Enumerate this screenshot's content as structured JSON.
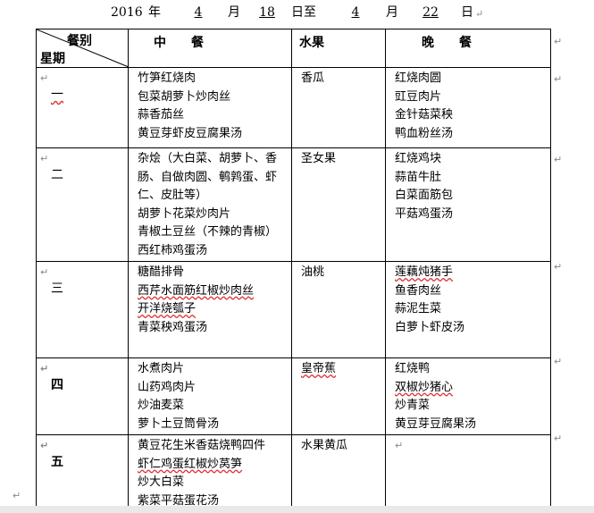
{
  "header": {
    "year": "2016",
    "year_char": "年",
    "start_month": "4",
    "month_char": "月",
    "start_day": "18",
    "day_to_char": "日至",
    "end_month": "4",
    "month_char2": "月",
    "end_day": "22",
    "day_char": "日"
  },
  "table": {
    "diag_top": "餐别",
    "diag_bottom": "星期",
    "col_lunch": "中　　餐",
    "col_fruit": "水果",
    "col_dinner": "晚　　餐",
    "rows": [
      {
        "day": "一",
        "lunch": [
          "竹笋红烧肉",
          "包菜胡萝卜炒肉丝",
          "蒜香茄丝",
          "黄豆芽虾皮豆腐果汤"
        ],
        "fruit": "香瓜",
        "dinner": [
          "红烧肉圆",
          "豇豆肉片",
          "金针菇菜秧",
          "鸭血粉丝汤"
        ]
      },
      {
        "day": "二",
        "lunch": [
          "杂烩（大白菜、胡萝卜、香",
          "肠、自做肉圆、鹌鹑蛋、虾",
          "仁、皮肚等）",
          "胡萝卜花菜炒肉片",
          "青椒土豆丝（不辣的青椒）",
          "西红柿鸡蛋汤"
        ],
        "fruit": "圣女果",
        "dinner": [
          "红烧鸡块",
          "蒜苗牛肚",
          "白菜面筋包",
          "平菇鸡蛋汤"
        ]
      },
      {
        "day": "三",
        "lunch": [
          "糖醋排骨",
          "西芹水面筋红椒炒肉丝",
          "开洋烧瓠子",
          "青菜秧鸡蛋汤"
        ],
        "fruit": "油桃",
        "dinner": [
          "莲藕炖猪手",
          "鱼香肉丝",
          "蒜泥生菜",
          "白萝卜虾皮汤"
        ]
      },
      {
        "day": "四",
        "lunch": [
          "水煮肉片",
          "山药鸡肉片",
          "炒油麦菜",
          "萝卜土豆筒骨汤"
        ],
        "fruit": "皇帝蕉",
        "dinner": [
          "红烧鸭",
          "双椒炒猪心",
          "炒青菜",
          "黄豆芽豆腐果汤"
        ]
      },
      {
        "day": "五",
        "lunch": [
          "黄豆花生米香菇烧鸭四件",
          "虾仁鸡蛋红椒炒莴笋",
          "炒大白菜",
          "紫菜平菇蛋花汤"
        ],
        "fruit": "水果黄瓜",
        "dinner": []
      }
    ]
  }
}
